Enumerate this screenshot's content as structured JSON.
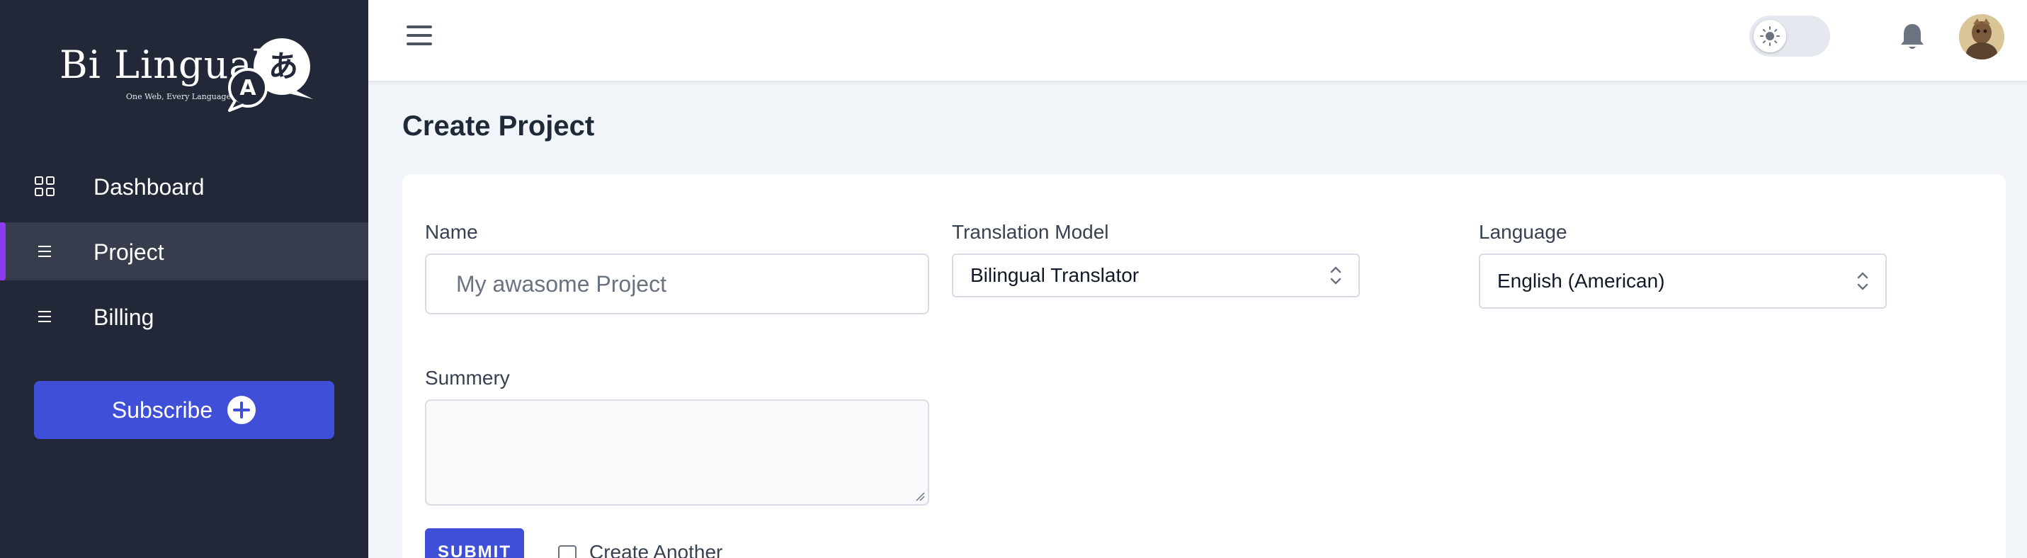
{
  "brand": {
    "name": "Bi Lingual",
    "tagline": "One Web, Every Language",
    "logo_glyph_a": "A",
    "logo_glyph_jp": "あ"
  },
  "sidebar": {
    "items": [
      {
        "label": "Dashboard",
        "icon": "grid-icon",
        "active": false
      },
      {
        "label": "Project",
        "icon": "list-icon",
        "active": true
      },
      {
        "label": "Billing",
        "icon": "list-icon",
        "active": false
      }
    ],
    "subscribe_label": "Subscribe"
  },
  "page": {
    "title": "Create Project"
  },
  "form": {
    "name_label": "Name",
    "name_placeholder": "My awasome Project",
    "model_label": "Translation Model",
    "model_value": "Bilingual Translator",
    "language_label": "Language",
    "language_value": "English (American)",
    "summary_label": "Summery",
    "submit_label": "SUBMIT",
    "create_another_label": "Create Another"
  },
  "colors": {
    "sidebar_bg": "#222838",
    "accent": "#3f4fd8",
    "active_indicator": "#8b3cf0"
  }
}
